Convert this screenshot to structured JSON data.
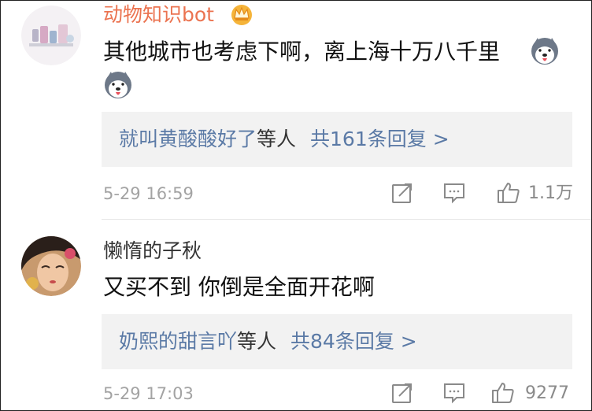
{
  "comments": [
    {
      "username": "动物知识bot",
      "content": "其他城市也考虑下啊，离上海十万八千里",
      "replies": {
        "users": "就叫黄酸酸好了",
        "middle": "等人",
        "count_text": "共161条回复 >"
      },
      "time": "5-29 16:59",
      "likes": "1.1万",
      "badge_icon": "crown-icon",
      "emoji_icon": "husky-emoji-icon"
    },
    {
      "username": "懒惰的子秋",
      "content": "又买不到 你倒是全面开花啊",
      "replies": {
        "users": "奶熙的甜言吖",
        "middle": "等人",
        "count_text": "共84条回复 >"
      },
      "time": "5-29 17:03",
      "likes": "9277"
    }
  ],
  "icons": {
    "forward": "forward-icon",
    "comment": "comment-icon",
    "like": "thumbs-up-icon"
  },
  "colors": {
    "username_highlight": "#eb7350",
    "link": "#5b7aa6",
    "meta": "#a3a3a3",
    "reply_bg": "#f2f2f2"
  }
}
